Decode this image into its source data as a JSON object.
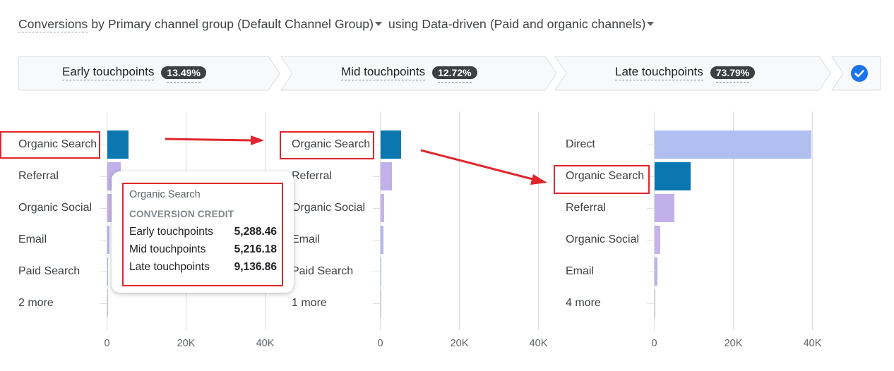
{
  "header": {
    "metric": "Conversions",
    "by_text": " by ",
    "dimension": "Primary channel group (Default Channel Group)",
    "using_text": " using ",
    "model": "Data-driven (Paid and organic channels)"
  },
  "steps": [
    {
      "label": "Early touchpoints",
      "percent": "13.49%"
    },
    {
      "label": "Mid touchpoints",
      "percent": "12.72%"
    },
    {
      "label": "Late touchpoints",
      "percent": "73.79%"
    }
  ],
  "check_icon": "check-circle-icon",
  "tooltip": {
    "title": "Organic Search",
    "subtitle": "CONVERSION CREDIT",
    "rows": [
      {
        "label": "Early touchpoints",
        "value": "5,288.46"
      },
      {
        "label": "Mid touchpoints",
        "value": "5,216.18"
      },
      {
        "label": "Late touchpoints",
        "value": "9,136.86"
      }
    ]
  },
  "colors": {
    "organic_search": "#0a77b0",
    "referral": "#c1b0ea",
    "organic_social": "#c8b3e8",
    "email": "#b5b5f0",
    "paid_search": "#a9c0e0",
    "direct": "#b0bff0",
    "more": "#c0c6d0",
    "annotation": "#e0262d"
  },
  "chart_data": [
    {
      "type": "bar",
      "orientation": "horizontal",
      "title": "Early touchpoints",
      "categories": [
        "Organic Search",
        "Referral",
        "Organic Social",
        "Email",
        "Paid Search",
        "2 more"
      ],
      "values": [
        5288.46,
        3400,
        1000,
        500,
        200,
        50
      ],
      "xlim": [
        0,
        40000
      ],
      "xticks": [
        "0",
        "20K",
        "40K"
      ],
      "grid": true
    },
    {
      "type": "bar",
      "orientation": "horizontal",
      "title": "Mid touchpoints",
      "categories": [
        "Organic Search",
        "Referral",
        "Organic Social",
        "Email",
        "Paid Search",
        "1 more"
      ],
      "values": [
        5216.18,
        2900,
        900,
        700,
        150,
        30
      ],
      "xlim": [
        0,
        40000
      ],
      "xticks": [
        "0",
        "20K",
        "40K"
      ],
      "grid": true
    },
    {
      "type": "bar",
      "orientation": "horizontal",
      "title": "Late touchpoints",
      "categories": [
        "Direct",
        "Organic Search",
        "Referral",
        "Organic Social",
        "Email",
        "4 more"
      ],
      "values": [
        39700,
        9136.86,
        5000,
        1400,
        700,
        50
      ],
      "xlim": [
        0,
        40000
      ],
      "xticks": [
        "0",
        "20K",
        "40K"
      ],
      "grid": true
    }
  ]
}
